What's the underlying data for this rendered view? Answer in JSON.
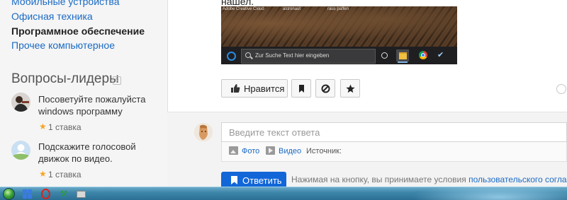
{
  "categories": [
    {
      "label": "Мобильные устройства",
      "active": false
    },
    {
      "label": "Офисная техника",
      "active": false
    },
    {
      "label": "Программное обеспечение",
      "active": true
    },
    {
      "label": "Прочее компьютерное",
      "active": false
    }
  ],
  "leaders": {
    "title": "Вопросы-лидеры",
    "info_icon": "question-mark-icon",
    "items": [
      {
        "text": "Посоветуйте пожалуйста windows программу",
        "stakes": "1 ставка"
      },
      {
        "text": "Подскажите голосовой движок по видео.",
        "stakes": "1 ставка"
      }
    ]
  },
  "post": {
    "found_text": "нашел.",
    "screenshot": {
      "desktop_icons": [
        "Adobe Creative Cloud",
        "astronaut",
        "raus paffen"
      ],
      "search_placeholder": "Zur Suche Text hier eingeben"
    }
  },
  "actions": {
    "like_label": "Нравится",
    "like_icon": "thumbs-up-icon",
    "bookmark_icon": "bookmark-icon",
    "block_icon": "block-icon",
    "star_icon": "star-icon"
  },
  "reply": {
    "placeholder": "Введите текст ответа",
    "photo_label": "Фото",
    "video_label": "Видео",
    "source_label": "Источник:",
    "submit_label": "Ответить",
    "terms_text": "Нажимая на кнопку, вы принимаете условия",
    "terms_link": "пользовательского соглашения"
  },
  "colors": {
    "link": "#1a6ac4",
    "primary_button": "#1266d8",
    "star": "#f5a623"
  }
}
